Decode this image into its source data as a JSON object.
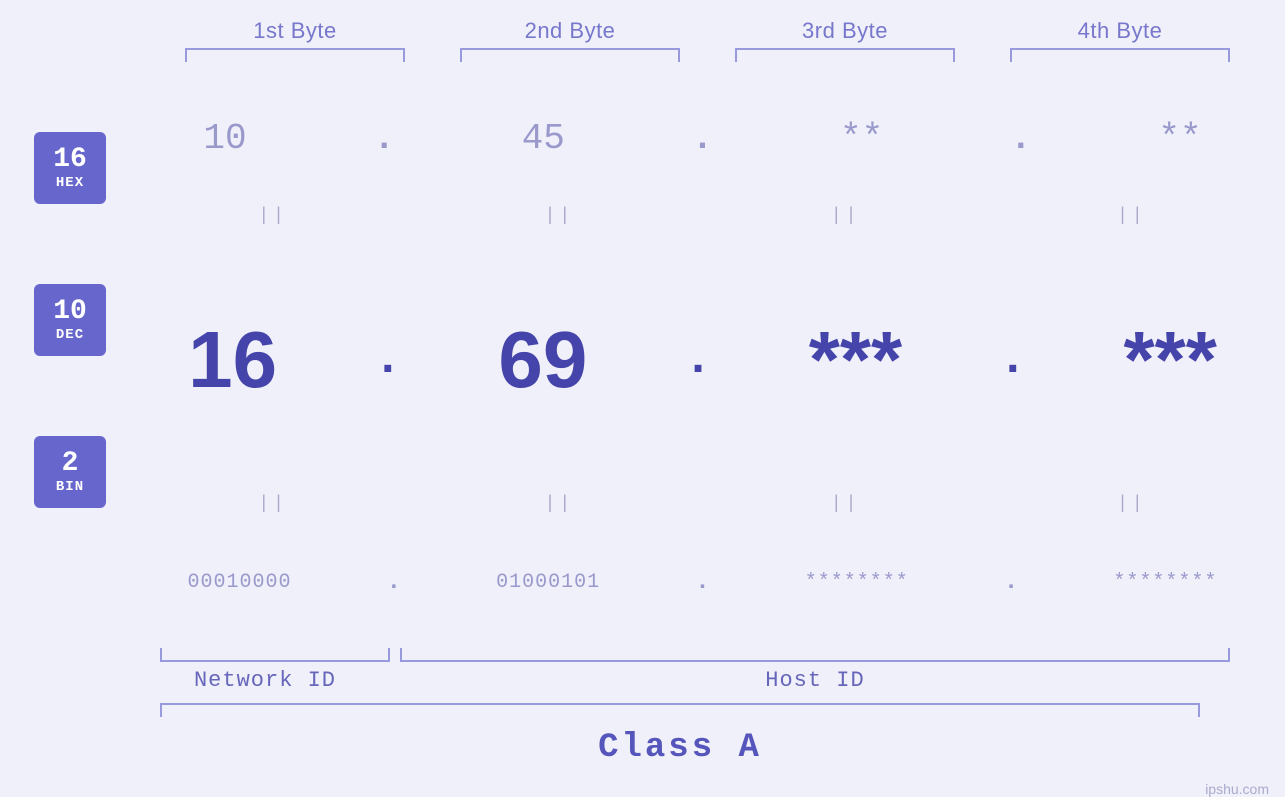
{
  "byteLabels": [
    "1st Byte",
    "2nd Byte",
    "3rd Byte",
    "4th Byte"
  ],
  "badges": [
    {
      "number": "16",
      "label": "HEX"
    },
    {
      "number": "10",
      "label": "DEC"
    },
    {
      "number": "2",
      "label": "BIN"
    }
  ],
  "hexRow": {
    "values": [
      "10",
      "45",
      "**",
      "**"
    ],
    "dots": [
      ".",
      ".",
      ".",
      ""
    ]
  },
  "decRow": {
    "values": [
      "16",
      "69",
      "***",
      "***"
    ],
    "dots": [
      ".",
      ".",
      ".",
      ""
    ]
  },
  "binRow": {
    "values": [
      "00010000",
      "01000101",
      "********",
      "********"
    ],
    "dots": [
      ".",
      ".",
      ".",
      ""
    ]
  },
  "networkIdLabel": "Network ID",
  "hostIdLabel": "Host ID",
  "classLabel": "Class A",
  "watermark": "ipshu.com",
  "equalsSymbol": "||",
  "accentColor": "#6666cc",
  "dimColor": "#9999cc",
  "darkColor": "#4444aa"
}
